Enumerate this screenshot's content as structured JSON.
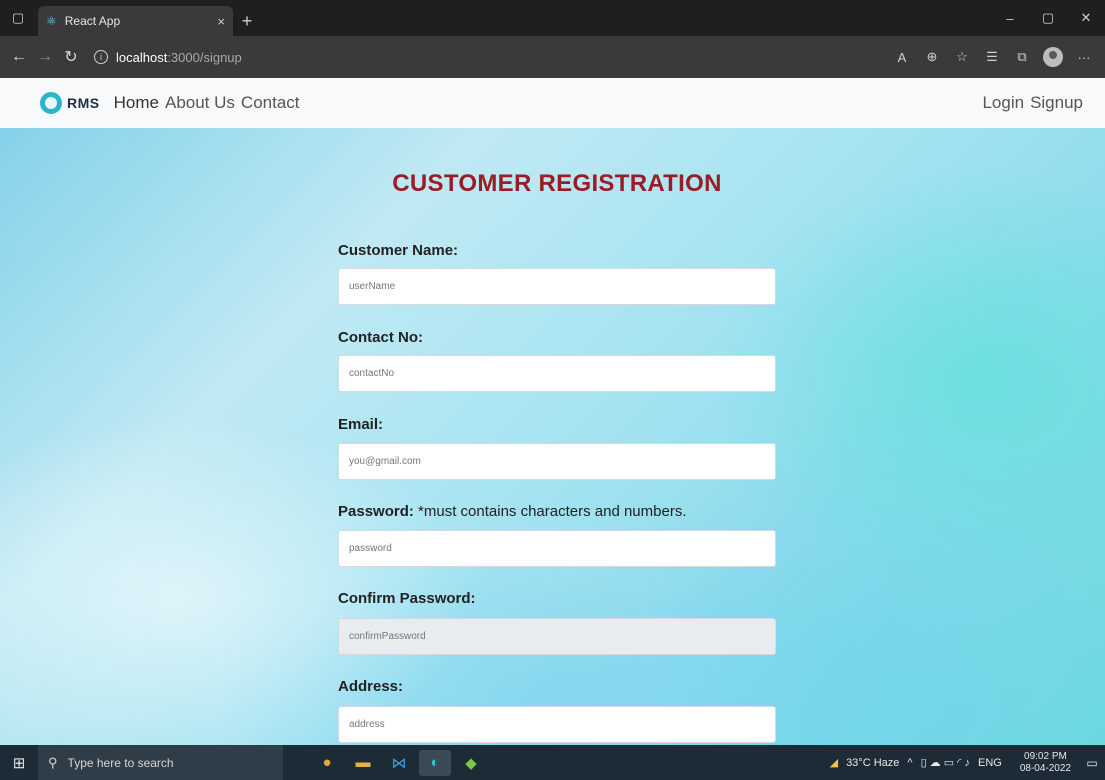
{
  "browser": {
    "tab_title": "React App",
    "tab_close": "×",
    "new_tab": "+",
    "url_host": "localhost",
    "url_path": ":3000/signup",
    "window_controls": [
      "–",
      "▢",
      "✕"
    ]
  },
  "navbar": {
    "brand": "RMS",
    "links": [
      "Home",
      "About Us",
      "Contact"
    ],
    "right_links": [
      "Login",
      "Signup"
    ]
  },
  "form": {
    "title": "CUSTOMER REGISTRATION",
    "fields": [
      {
        "label": "Customer Name:",
        "placeholder": "userName"
      },
      {
        "label": "Contact No:",
        "placeholder": "contactNo"
      },
      {
        "label": "Email:",
        "placeholder": "you@gmail.com"
      },
      {
        "label": "Password:",
        "note": "*must contains characters and numbers.",
        "placeholder": "password"
      },
      {
        "label": "Confirm Password:",
        "placeholder": "confirmPassword"
      },
      {
        "label": "Address:",
        "placeholder": "address"
      }
    ]
  },
  "taskbar": {
    "search_placeholder": "Type here to search",
    "weather": "33°C Haze",
    "lang": "ENG",
    "time": "09:02 PM",
    "date": "08-04-2022"
  },
  "colors": {
    "title": "#9b1c25",
    "brand": "#2bb5c9"
  }
}
